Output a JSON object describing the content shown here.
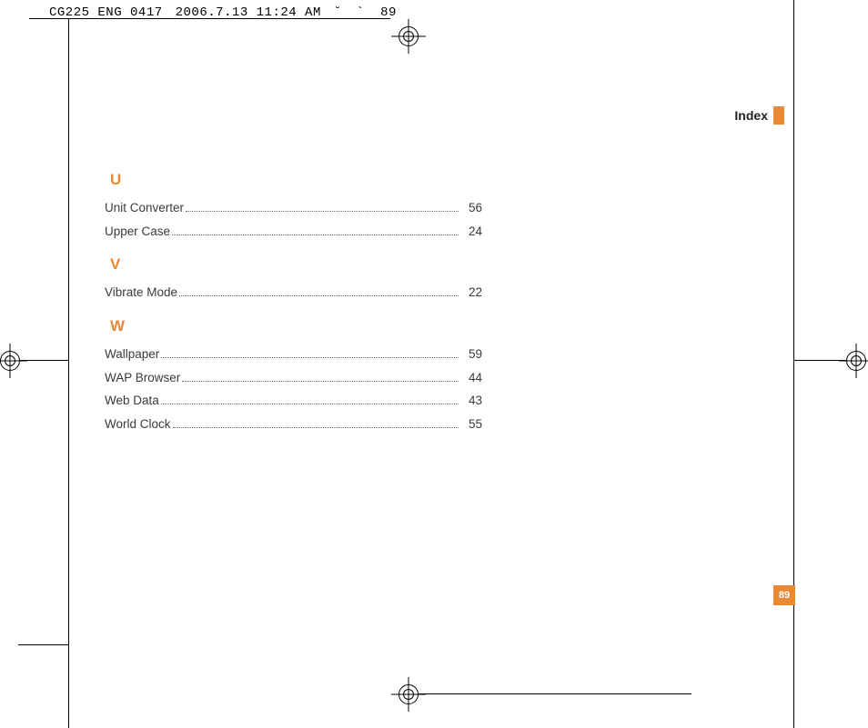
{
  "imprint": {
    "doc_id": "CG225 ENG 0417",
    "timestamp": "2006.7.13 11:24 AM",
    "glyphs": "˘    `",
    "page": "89"
  },
  "running_header": {
    "label": "Index"
  },
  "page_number": "89",
  "sections": [
    {
      "letter": "U",
      "entries": [
        {
          "term": "Unit Converter",
          "page": "56"
        },
        {
          "term": "Upper Case",
          "page": "24"
        }
      ]
    },
    {
      "letter": "V",
      "entries": [
        {
          "term": "Vibrate Mode",
          "page": "22"
        }
      ]
    },
    {
      "letter": "W",
      "entries": [
        {
          "term": "Wallpaper",
          "page": "59"
        },
        {
          "term": "WAP Browser",
          "page": "44"
        },
        {
          "term": "Web Data",
          "page": "43"
        },
        {
          "term": "World Clock",
          "page": "55"
        }
      ]
    }
  ]
}
